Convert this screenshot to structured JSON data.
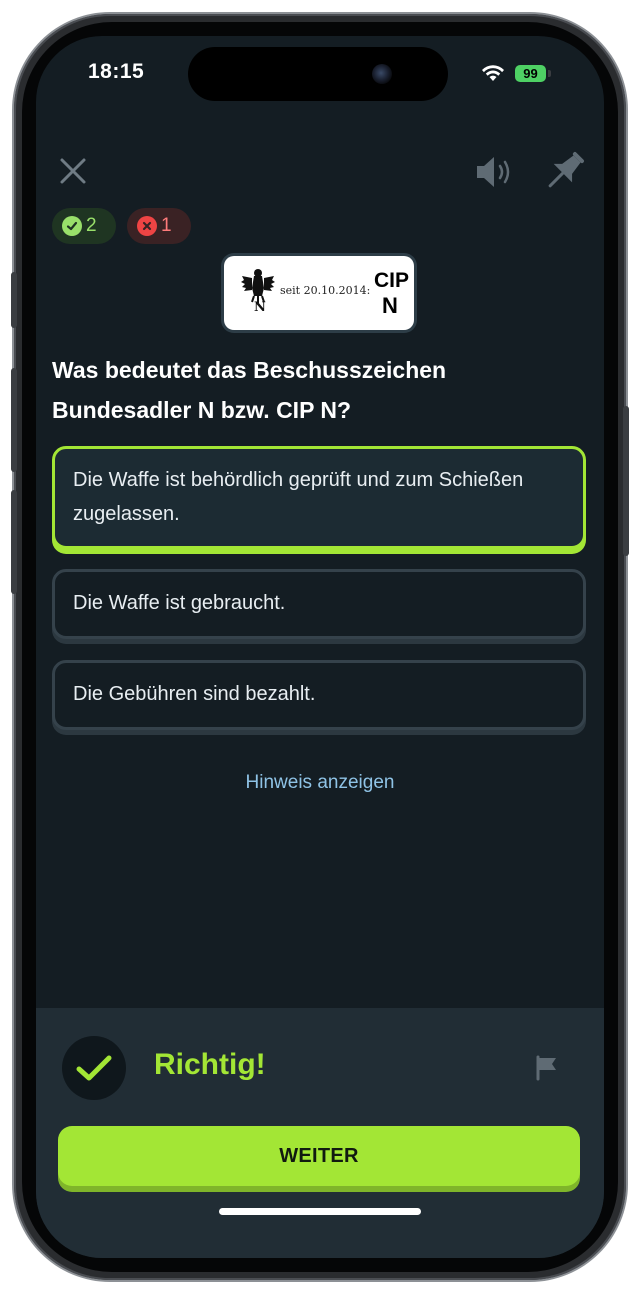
{
  "status_bar": {
    "time": "18:15",
    "battery": "99"
  },
  "toolbar": {
    "close_icon": "close-icon",
    "speaker_icon": "speaker-icon",
    "pin_icon": "pin-icon"
  },
  "score": {
    "correct_count": "2",
    "wrong_count": "1"
  },
  "proof_mark": {
    "small_letter": "N",
    "date_text": "seit 20.10.2014:",
    "cip_text": "CIP",
    "big_letter": "N"
  },
  "question": {
    "text": "Was bedeutet das Beschusszeichen Bundesadler N bzw. CIP N?"
  },
  "answers": [
    {
      "text": "Die Waffe ist behördlich geprüft und zum Schießen zugelassen.",
      "selected": true
    },
    {
      "text": "Die Waffe ist gebraucht.",
      "selected": false
    },
    {
      "text": "Die Gebühren sind bezahlt.",
      "selected": false
    }
  ],
  "hint": {
    "label": "Hinweis anzeigen"
  },
  "result": {
    "title": "Richtig!",
    "continue_label": "WEITER"
  },
  "colors": {
    "accent": "#a3e635",
    "background": "#141d23",
    "panel": "#212d35",
    "wrong": "#ef4444"
  }
}
